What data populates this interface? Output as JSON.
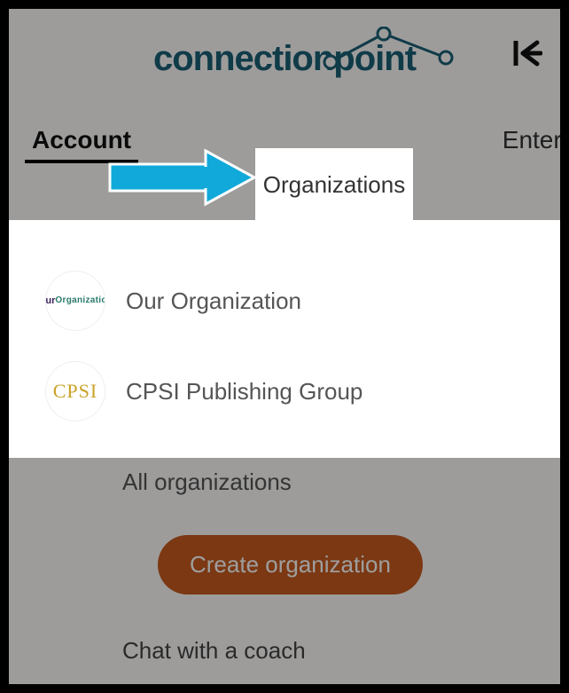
{
  "brand": {
    "part1": "connection",
    "part2": "point"
  },
  "tabs": {
    "account": "Account",
    "organizations": "Organizations",
    "enterprise": "Enterprise"
  },
  "dropdown": {
    "items": [
      {
        "avatar_line1": "Our",
        "avatar_line2": "Organization",
        "name": "Our Organization"
      },
      {
        "avatar_text": "CPSI",
        "name": "CPSI Publishing Group"
      }
    ]
  },
  "below": {
    "all_label": "All organizations",
    "create_label": "Create organization",
    "chat_label": "Chat with a coach"
  },
  "colors": {
    "brand_teal": "#1a5f74",
    "arrow_blue": "#11A9DA",
    "button_orange": "#c75b1f"
  }
}
